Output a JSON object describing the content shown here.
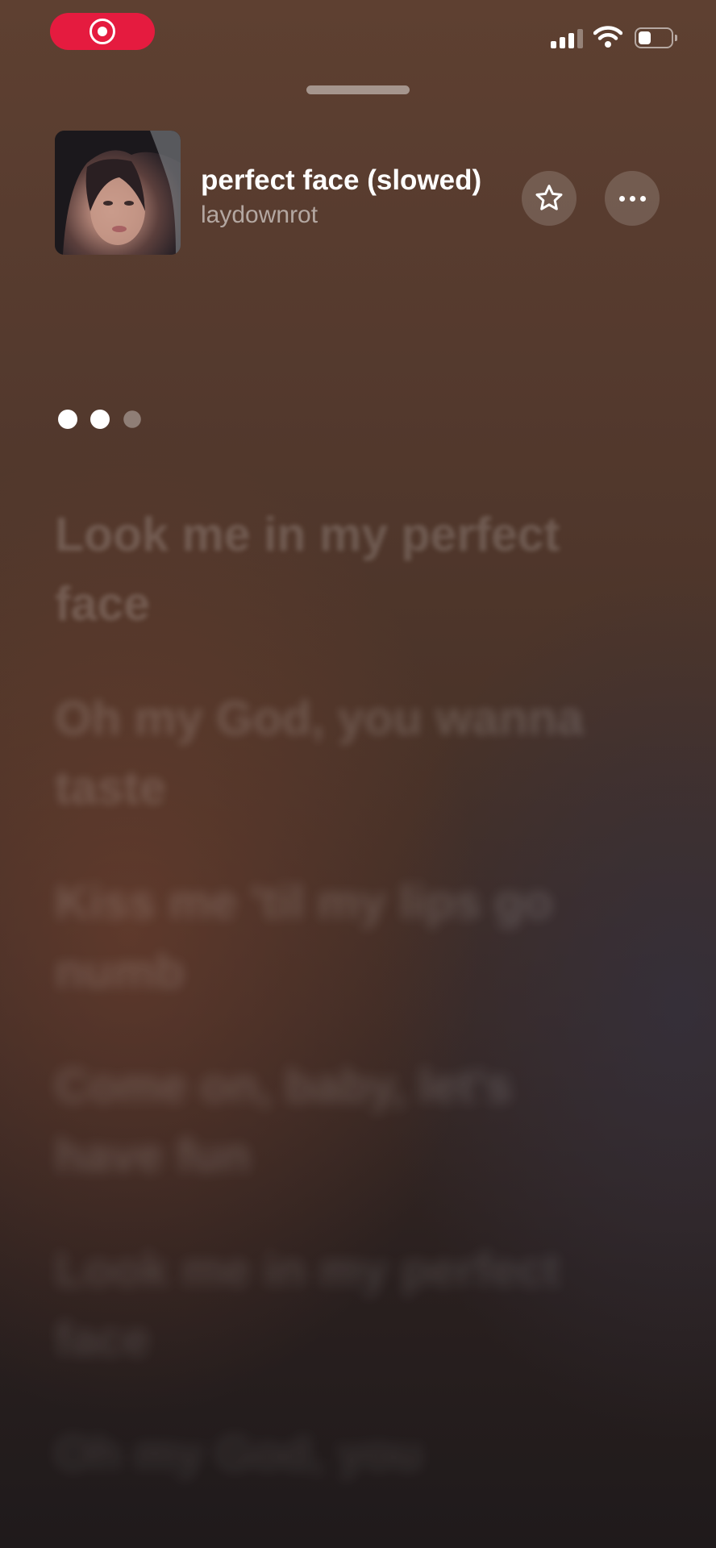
{
  "status_bar": {
    "record_icon": "screen-recording-icon",
    "signal_icon": "cellular-signal-icon",
    "wifi_icon": "wifi-icon",
    "battery_icon": "battery-icon",
    "battery_level": 0.4,
    "record_color": "#e51b3f"
  },
  "now_playing": {
    "title": "perfect face (slowed)",
    "artist": "laydownrot",
    "favorite_icon": "star-icon",
    "more_icon": "ellipsis-icon"
  },
  "lyrics": {
    "lines": [
      "Look me in my perfect face",
      "Oh my God, you wanna taste",
      "Kiss me 'til my lips go numb",
      "Come on, baby, let's have fun",
      "Look me in my perfect face",
      "Oh my God, you"
    ]
  }
}
